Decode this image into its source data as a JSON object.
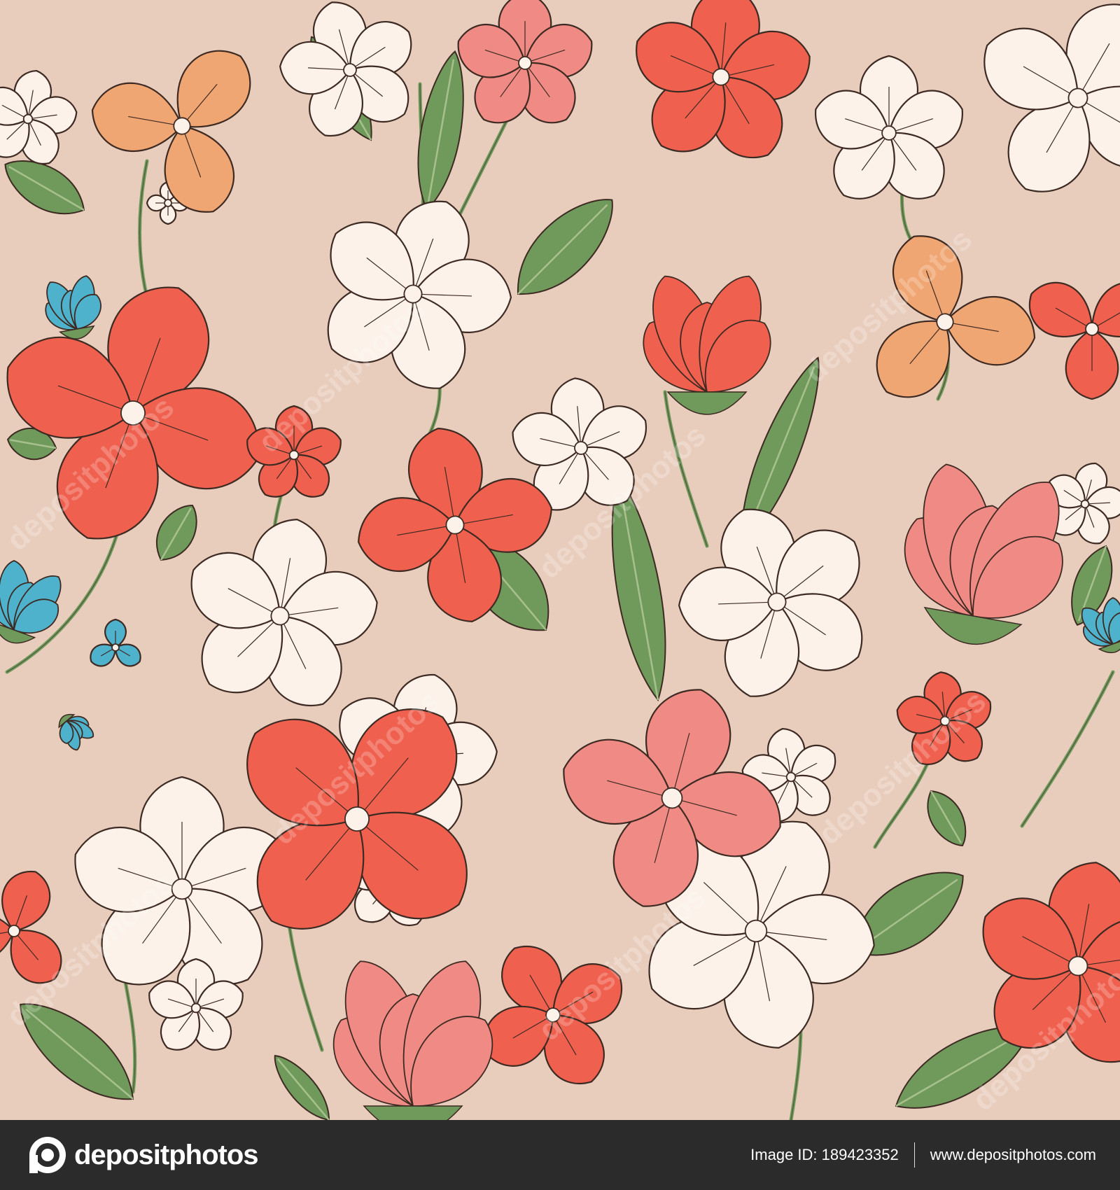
{
  "pattern": {
    "background_color": "#e8cdbd",
    "colors": {
      "coral": "#f0604f",
      "salmon": "#f08a84",
      "peach": "#f0a673",
      "cream": "#fcf2ea",
      "leaf": "#6f9a5c",
      "leaf_light": "#a8c08e",
      "blue": "#4fb2cc",
      "ink": "#3d2a22"
    },
    "watermark": "depositphotos"
  },
  "footer": {
    "brand": "depositphotos",
    "image_id_label": "Image ID: 189423352",
    "site": "www.depositphotos.com"
  }
}
